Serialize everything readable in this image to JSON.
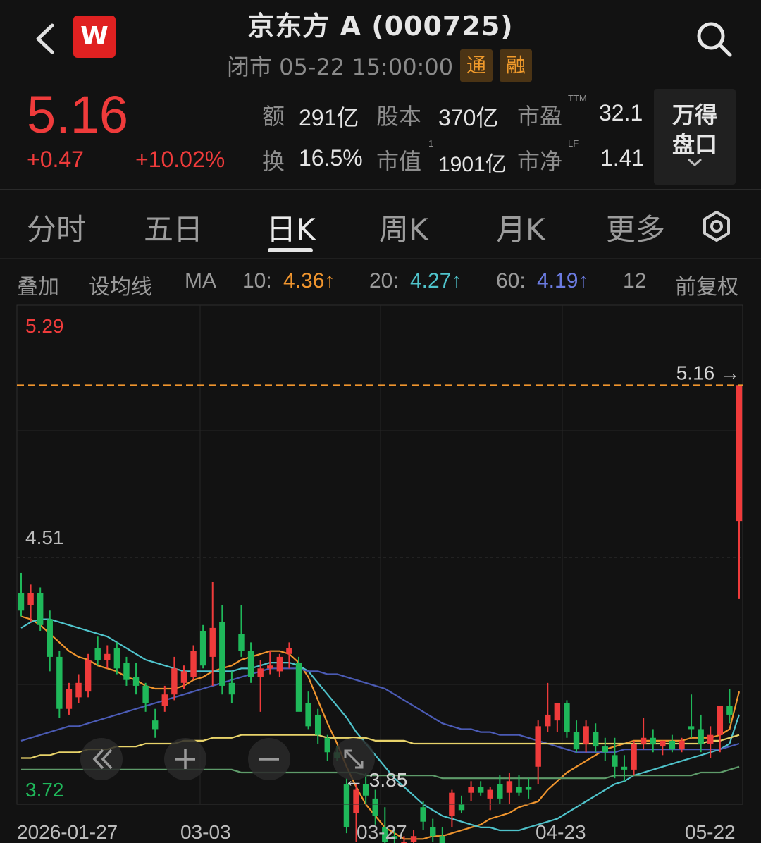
{
  "header": {
    "title": "京东方 A (000725)",
    "status": "闭市 05-22 15:00:00",
    "logo_letter": "W",
    "tags": [
      "通",
      "融"
    ]
  },
  "quote": {
    "price": "5.16",
    "change": "+0.47",
    "change_pct": "+10.02%",
    "stats": {
      "amount_label": "额",
      "amount": "291亿",
      "shares_label": "股本",
      "shares": "370亿",
      "pe_label": "市盈",
      "pe_sup": "TTM",
      "pe": "32.1",
      "turnover_label": "换",
      "turnover": "16.5%",
      "mktcap_label": "市值",
      "mktcap_sup": "1",
      "mktcap": "1901亿",
      "pb_label": "市净",
      "pb_sup": "LF",
      "pb": "1.41"
    },
    "pankou_line1": "万得",
    "pankou_line2": "盘口"
  },
  "tabs": [
    {
      "label": "分时"
    },
    {
      "label": "五日"
    },
    {
      "label": "日K"
    },
    {
      "label": "周K"
    },
    {
      "label": "月K"
    },
    {
      "label": "更多"
    }
  ],
  "ma": {
    "overlay": "叠加",
    "set_ma": "设均线",
    "ma": "MA",
    "ma10_label": "10:",
    "ma10": "4.36↑",
    "ma20_label": "20:",
    "ma20": "4.27↑",
    "ma60_label": "60:",
    "ma60": "4.19↑",
    "extra": "12",
    "adjust": "前复权"
  },
  "colors": {
    "up": "#ef3b3b",
    "down": "#1fb85a",
    "ma10": "#f0952e",
    "ma20": "#4fc3cb",
    "ma60": "#4b5bb5",
    "ma_yellow": "#e8d36a",
    "ma_green": "#5e9b6a"
  },
  "chart_data": {
    "type": "candlestick",
    "top_price": "5.29",
    "bottom_price": "3.72",
    "ylim": [
      3.72,
      5.29
    ],
    "current_line": "5.16 →",
    "current_value": 5.16,
    "high_mark": "4.51",
    "low_mark": "← 3.85",
    "x_ticks": [
      "2026-01-27",
      "03-03",
      "03-27",
      "04-23",
      "05-22"
    ],
    "candles": [
      [
        4.44,
        4.51,
        4.36,
        4.38
      ],
      [
        4.4,
        4.47,
        4.34,
        4.44
      ],
      [
        4.44,
        4.46,
        4.31,
        4.33
      ],
      [
        4.35,
        4.38,
        4.17,
        4.22
      ],
      [
        4.22,
        4.24,
        4.01,
        4.04
      ],
      [
        4.04,
        4.13,
        4.02,
        4.11
      ],
      [
        4.08,
        4.16,
        4.06,
        4.13
      ],
      [
        4.1,
        4.23,
        4.08,
        4.21
      ],
      [
        4.25,
        4.29,
        4.19,
        4.21
      ],
      [
        4.21,
        4.26,
        4.18,
        4.23
      ],
      [
        4.25,
        4.27,
        4.16,
        4.18
      ],
      [
        4.2,
        4.22,
        4.12,
        4.14
      ],
      [
        4.15,
        4.2,
        4.09,
        4.12
      ],
      [
        4.12,
        4.13,
        4.03,
        4.06
      ],
      [
        4.0,
        4.04,
        3.94,
        3.97
      ],
      [
        4.05,
        4.12,
        4.03,
        4.09
      ],
      [
        4.09,
        4.22,
        4.07,
        4.18
      ],
      [
        4.13,
        4.19,
        4.11,
        4.17
      ],
      [
        4.15,
        4.26,
        4.14,
        4.24
      ],
      [
        4.31,
        4.33,
        4.18,
        4.19
      ],
      [
        4.22,
        4.48,
        4.12,
        4.32
      ],
      [
        4.34,
        4.4,
        4.09,
        4.12
      ],
      [
        4.13,
        4.17,
        4.06,
        4.09
      ],
      [
        4.3,
        4.4,
        4.22,
        4.24
      ],
      [
        4.24,
        4.27,
        4.13,
        4.15
      ],
      [
        4.15,
        4.21,
        4.03,
        4.18
      ],
      [
        4.18,
        4.24,
        4.16,
        4.19
      ],
      [
        4.17,
        4.23,
        4.15,
        4.22
      ],
      [
        4.23,
        4.27,
        4.18,
        4.25
      ],
      [
        4.2,
        4.22,
        4.05,
        4.03
      ],
      [
        4.06,
        4.1,
        3.97,
        3.98
      ],
      [
        4.02,
        4.04,
        3.92,
        3.95
      ],
      [
        3.94,
        3.95,
        3.86,
        3.89
      ],
      [
        3.89,
        3.91,
        3.86,
        3.87
      ],
      [
        3.78,
        3.8,
        3.61,
        3.63
      ],
      [
        3.68,
        3.78,
        3.58,
        3.76
      ],
      [
        3.78,
        3.82,
        3.71,
        3.74
      ],
      [
        3.73,
        3.76,
        3.64,
        3.67
      ],
      [
        3.63,
        3.7,
        3.57,
        3.58
      ],
      [
        3.6,
        3.63,
        3.56,
        3.59
      ],
      [
        3.56,
        3.6,
        3.56,
        3.58
      ],
      [
        3.58,
        3.62,
        3.54,
        3.6
      ],
      [
        3.7,
        3.72,
        3.62,
        3.65
      ],
      [
        3.63,
        3.66,
        3.58,
        3.6
      ],
      [
        3.6,
        3.63,
        3.55,
        3.57
      ],
      [
        3.67,
        3.76,
        3.63,
        3.75
      ],
      [
        3.71,
        3.74,
        3.68,
        3.69
      ],
      [
        3.75,
        3.79,
        3.72,
        3.77
      ],
      [
        3.77,
        3.79,
        3.74,
        3.75
      ],
      [
        3.73,
        3.77,
        3.69,
        3.76
      ],
      [
        3.78,
        3.81,
        3.71,
        3.73
      ],
      [
        3.75,
        3.82,
        3.71,
        3.79
      ],
      [
        3.77,
        3.81,
        3.74,
        3.75
      ],
      [
        3.77,
        3.8,
        3.73,
        3.76
      ],
      [
        3.84,
        4.0,
        3.78,
        3.98
      ],
      [
        3.98,
        4.13,
        3.96,
        4.02
      ],
      [
        4.0,
        4.06,
        3.96,
        4.06
      ],
      [
        4.06,
        4.07,
        3.94,
        3.96
      ],
      [
        3.96,
        4.0,
        3.89,
        3.9
      ],
      [
        3.92,
        4.0,
        3.89,
        3.98
      ],
      [
        3.96,
        3.99,
        3.89,
        3.91
      ],
      [
        3.91,
        3.94,
        3.86,
        3.89
      ],
      [
        3.88,
        3.94,
        3.8,
        3.84
      ],
      [
        3.84,
        3.88,
        3.79,
        3.83
      ],
      [
        3.83,
        3.93,
        3.81,
        3.92
      ],
      [
        3.92,
        4.01,
        3.9,
        3.94
      ],
      [
        3.94,
        3.97,
        3.89,
        3.92
      ],
      [
        3.91,
        3.93,
        3.88,
        3.93
      ],
      [
        3.93,
        3.95,
        3.89,
        3.9
      ],
      [
        3.9,
        3.94,
        3.89,
        3.93
      ],
      [
        3.98,
        4.09,
        3.94,
        3.97
      ],
      [
        3.97,
        4.02,
        3.89,
        3.92
      ],
      [
        3.92,
        3.98,
        3.87,
        3.95
      ],
      [
        3.95,
        4.04,
        3.89,
        4.05
      ],
      [
        4.05,
        4.11,
        3.99,
        4.02
      ],
      [
        4.69,
        5.16,
        4.42,
        5.16
      ]
    ],
    "ma_series": [
      {
        "name": "MA10",
        "values": [
          4.36,
          4.35,
          4.33,
          4.3,
          4.27,
          4.24,
          4.22,
          4.21,
          4.19,
          4.18,
          4.17,
          4.15,
          4.14,
          4.12,
          4.11,
          4.11,
          4.11,
          4.12,
          4.14,
          4.15,
          4.17,
          4.18,
          4.19,
          4.21,
          4.22,
          4.23,
          4.24,
          4.24,
          4.23,
          4.2,
          4.15,
          4.07,
          3.99,
          3.92,
          3.84,
          3.77,
          3.71,
          3.67,
          3.63,
          3.61,
          3.59,
          3.59,
          3.59,
          3.6,
          3.6,
          3.61,
          3.62,
          3.63,
          3.64,
          3.66,
          3.67,
          3.68,
          3.7,
          3.71,
          3.72,
          3.76,
          3.79,
          3.82,
          3.84,
          3.86,
          3.88,
          3.9,
          3.91,
          3.92,
          3.93,
          3.93,
          3.93,
          3.93,
          3.93,
          3.93,
          3.94,
          3.94,
          3.94,
          3.95,
          3.97,
          4.1
        ]
      },
      {
        "name": "MA20",
        "values": [
          4.32,
          4.34,
          4.35,
          4.35,
          4.34,
          4.33,
          4.32,
          4.31,
          4.3,
          4.29,
          4.27,
          4.25,
          4.23,
          4.21,
          4.2,
          4.19,
          4.18,
          4.17,
          4.17,
          4.17,
          4.17,
          4.17,
          4.17,
          4.18,
          4.18,
          4.19,
          4.2,
          4.2,
          4.2,
          4.19,
          4.17,
          4.13,
          4.09,
          4.05,
          4.01,
          3.96,
          3.92,
          3.88,
          3.84,
          3.8,
          3.77,
          3.74,
          3.71,
          3.69,
          3.67,
          3.66,
          3.65,
          3.64,
          3.63,
          3.63,
          3.62,
          3.62,
          3.62,
          3.63,
          3.64,
          3.65,
          3.66,
          3.68,
          3.7,
          3.72,
          3.74,
          3.76,
          3.78,
          3.79,
          3.81,
          3.82,
          3.83,
          3.84,
          3.85,
          3.86,
          3.87,
          3.88,
          3.89,
          3.9,
          3.92,
          4.02
        ]
      },
      {
        "name": "MA60",
        "values": [
          3.93,
          3.94,
          3.95,
          3.96,
          3.97,
          3.98,
          3.98,
          3.99,
          4.0,
          4.01,
          4.02,
          4.03,
          4.04,
          4.05,
          4.06,
          4.07,
          4.08,
          4.09,
          4.1,
          4.11,
          4.12,
          4.13,
          4.14,
          4.15,
          4.16,
          4.17,
          4.18,
          4.18,
          4.18,
          4.18,
          4.17,
          4.17,
          4.16,
          4.16,
          4.15,
          4.14,
          4.13,
          4.12,
          4.11,
          4.09,
          4.07,
          4.05,
          4.03,
          4.01,
          3.99,
          3.98,
          3.97,
          3.97,
          3.96,
          3.96,
          3.95,
          3.95,
          3.95,
          3.94,
          3.93,
          3.92,
          3.91,
          3.9,
          3.89,
          3.89,
          3.89,
          3.89,
          3.89,
          3.9,
          3.9,
          3.9,
          3.9,
          3.9,
          3.9,
          3.9,
          3.9,
          3.9,
          3.9,
          3.9,
          3.91,
          3.92
        ]
      },
      {
        "name": "MA-yellow",
        "values": [
          3.87,
          3.87,
          3.88,
          3.88,
          3.89,
          3.89,
          3.89,
          3.9,
          3.9,
          3.9,
          3.91,
          3.91,
          3.91,
          3.92,
          3.92,
          3.92,
          3.92,
          3.93,
          3.93,
          3.93,
          3.94,
          3.94,
          3.94,
          3.95,
          3.95,
          3.95,
          3.95,
          3.95,
          3.95,
          3.95,
          3.95,
          3.95,
          3.94,
          3.94,
          3.94,
          3.94,
          3.94,
          3.93,
          3.93,
          3.93,
          3.93,
          3.92,
          3.92,
          3.92,
          3.92,
          3.92,
          3.92,
          3.92,
          3.92,
          3.92,
          3.92,
          3.92,
          3.92,
          3.92,
          3.92,
          3.92,
          3.92,
          3.92,
          3.92,
          3.92,
          3.92,
          3.92,
          3.92,
          3.92,
          3.92,
          3.92,
          3.92,
          3.92,
          3.92,
          3.92,
          3.92,
          3.92,
          3.93,
          3.93,
          3.94,
          3.95
        ]
      },
      {
        "name": "MA-green",
        "values": [
          3.83,
          3.83,
          3.83,
          3.83,
          3.83,
          3.83,
          3.83,
          3.83,
          3.83,
          3.83,
          3.83,
          3.83,
          3.83,
          3.83,
          3.83,
          3.83,
          3.83,
          3.83,
          3.83,
          3.83,
          3.83,
          3.83,
          3.83,
          3.82,
          3.82,
          3.82,
          3.82,
          3.82,
          3.82,
          3.82,
          3.82,
          3.82,
          3.82,
          3.82,
          3.82,
          3.82,
          3.81,
          3.81,
          3.81,
          3.81,
          3.81,
          3.81,
          3.81,
          3.81,
          3.8,
          3.8,
          3.8,
          3.8,
          3.8,
          3.8,
          3.8,
          3.8,
          3.8,
          3.8,
          3.8,
          3.8,
          3.8,
          3.8,
          3.8,
          3.8,
          3.8,
          3.8,
          3.81,
          3.81,
          3.81,
          3.81,
          3.81,
          3.81,
          3.81,
          3.81,
          3.81,
          3.82,
          3.82,
          3.82,
          3.83,
          3.84
        ]
      }
    ]
  }
}
